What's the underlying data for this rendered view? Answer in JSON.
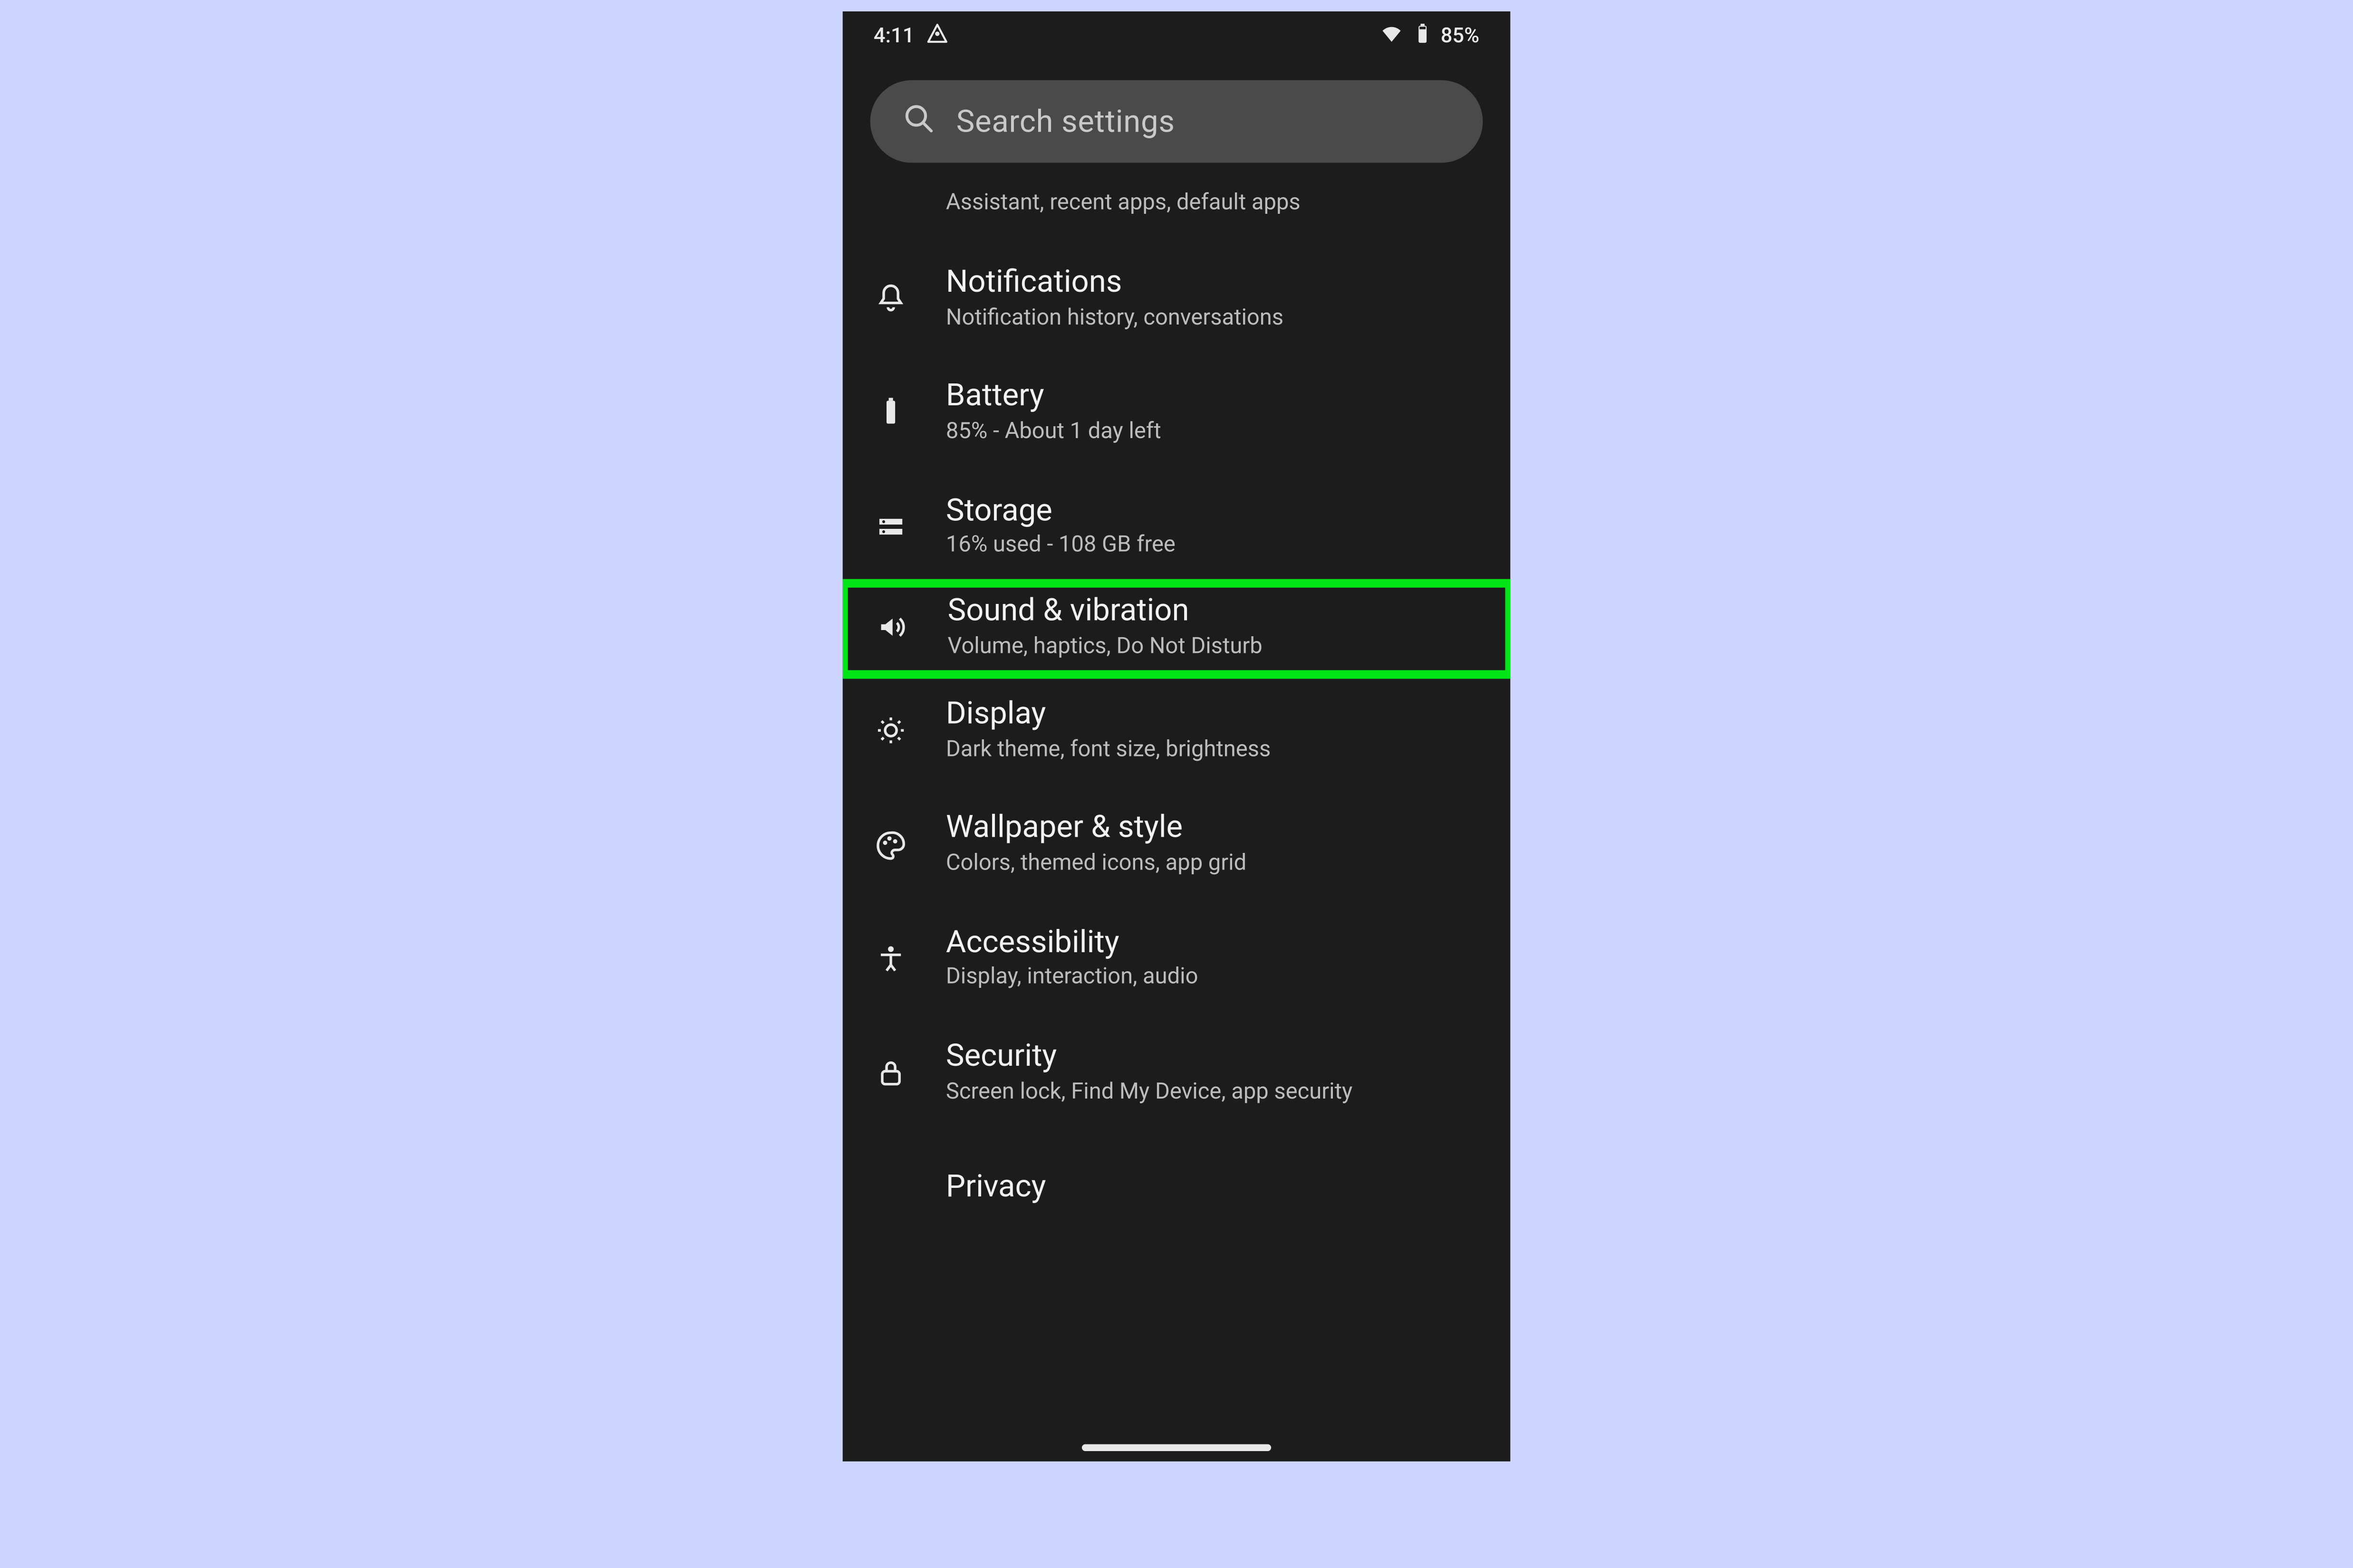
{
  "statusbar": {
    "time": "4:11",
    "battery_text": "85%"
  },
  "search": {
    "placeholder": "Search settings"
  },
  "rows": {
    "apps_sub": "Assistant, recent apps, default apps",
    "notifications": {
      "title": "Notifications",
      "sub": "Notification history, conversations"
    },
    "battery": {
      "title": "Battery",
      "sub": "85% - About 1 day left"
    },
    "storage": {
      "title": "Storage",
      "sub": "16% used - 108 GB free"
    },
    "sound": {
      "title": "Sound & vibration",
      "sub": "Volume, haptics, Do Not Disturb"
    },
    "display": {
      "title": "Display",
      "sub": "Dark theme, font size, brightness"
    },
    "wallpaper": {
      "title": "Wallpaper & style",
      "sub": "Colors, themed icons, app grid"
    },
    "accessibility": {
      "title": "Accessibility",
      "sub": "Display, interaction, audio"
    },
    "security": {
      "title": "Security",
      "sub": "Screen lock, Find My Device, app security"
    },
    "privacy": {
      "title": "Privacy"
    }
  },
  "highlight": "sound",
  "colors": {
    "bg": "#ced6ff",
    "phone_bg": "#1c1c1c",
    "highlight_border": "#00e317"
  }
}
